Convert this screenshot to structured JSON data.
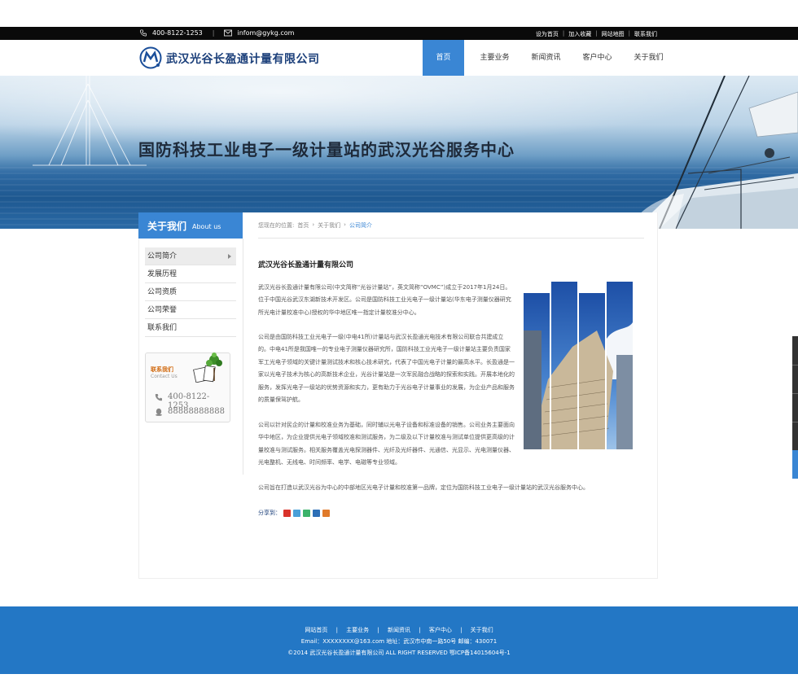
{
  "topbar": {
    "phone": "400-8122-1253",
    "email": "infom@gykg.com",
    "links": [
      "设为首页",
      "加入收藏",
      "网站地图",
      "联系我们"
    ],
    "separator": "|"
  },
  "header": {
    "logo_text": "武汉光谷长盈通计量有限公司",
    "nav": [
      "首页",
      "主要业务",
      "新闻资讯",
      "客户中心",
      "关于我们"
    ],
    "active_nav": "首页"
  },
  "banner": {
    "slogan": "国防科技工业电子一级计量站的武汉光谷服务中心"
  },
  "sidebar": {
    "title_zh": "关于我们",
    "title_en": "About us",
    "items": [
      "公司简介",
      "发展历程",
      "公司资质",
      "公司荣誉",
      "联系我们"
    ],
    "active_item": "公司简介",
    "contact": {
      "title_zh": "联系我们",
      "title_en": "Contact Us",
      "phone": "400-8122-1253",
      "qq": "88888888888"
    }
  },
  "breadcrumb": {
    "prefix": "您现在的位置:",
    "items": [
      "首页",
      "关于我们"
    ],
    "current": "公司简介",
    "sep": "›"
  },
  "article": {
    "title": "武汉光谷长盈通计量有限公司",
    "paragraphs": [
      "武汉光谷长盈通计量有限公司(中文简称“光谷计量站”，英文简称“OVMC”)成立于2017年1月24日。位于中国光谷武汉东湖新技术开发区。公司是国防科技工业光电子一级计量站(华东电子测量仪器研究所光电计量校准中心)授权的华中地区唯一指定计量校准分中心。",
      "公司是由国防科技工业光电子一级(中电41所)计量站与武汉长盈通光电技术有限公司联合共建成立的。中电41所是我国唯一的专业电子测量仪器研究所，国防科技工业光电子一级计量站主要负责国家军工光电子领域的关键计量测试技术和核心技术研究，代表了中国光电子计量的最高水平。长盈通是一家以光电子技术为核心的高新技术企业，光谷计量站是一次军民融合战略的探索和实践。开展本地化的服务，发挥光电子一级站的优势资源和实力，更有助力于光谷电子计量事业的发展，为企业产品和服务的质量保驾护航。",
      "公司以针对民企的计量和校准业务为基础，同时辅以光电子设备和标准设备的销售。公司业务主要面向华中地区，为企业提供光电子领域校准和测试服务，为二级及以下计量校准与测试单位提供更高级的计量校准与测试服务。相关服务覆盖光电探测器件、光纤及光纤器件、光通信、光显示、光电测量仪器、光电整机、无线电、时间频率、电学、电磁等专业领域。",
      "公司旨在打造以武汉光谷为中心的中部地区光电子计量和校准第一品牌，定位为国防科技工业电子一级计量站的武汉光谷服务中心。"
    ],
    "share_label": "分享到："
  },
  "footer": {
    "nav": [
      "网站首页",
      "主要业务",
      "新闻资讯",
      "客户中心",
      "关于我们"
    ],
    "nav_sep": "|",
    "address": "Email：XXXXXXXX@163.com   地址：武汉市中南一路50号   邮编：430071",
    "copyright": "©2014 武汉光谷长盈通计量有限公司 ALL RIGHT RESERVED      鄂ICP备14015604号-1"
  },
  "colors": {
    "accent": "#3a86d4",
    "footer": "#2377c5",
    "topbar": "#0a0a0a"
  }
}
